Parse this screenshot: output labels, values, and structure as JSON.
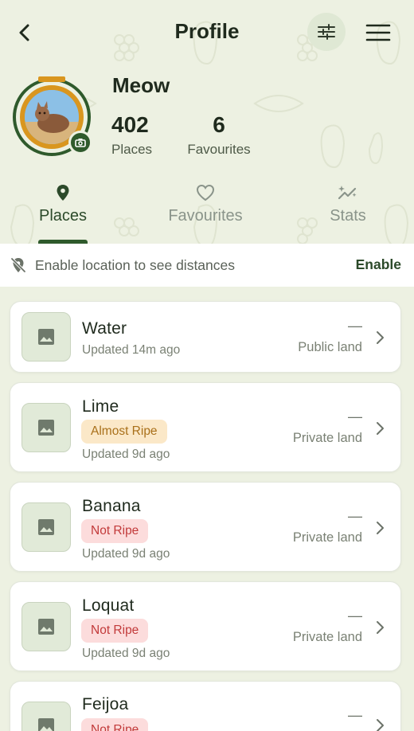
{
  "header": {
    "title": "Profile",
    "back_icon": "chevron-left-icon",
    "filter_icon": "sliders-icon",
    "menu_icon": "hamburger-menu-icon"
  },
  "profile": {
    "name": "Meow",
    "places_count": "402",
    "places_label": "Places",
    "favourites_count": "6",
    "favourites_label": "Favourites"
  },
  "tabs": [
    {
      "label": "Places",
      "icon": "map-pin-icon",
      "active": true
    },
    {
      "label": "Favourites",
      "icon": "heart-icon",
      "active": false
    },
    {
      "label": "Stats",
      "icon": "trend-sparkle-icon",
      "active": false
    }
  ],
  "banner": {
    "text": "Enable location to see distances",
    "action": "Enable",
    "icon": "location-off-icon"
  },
  "places": [
    {
      "name": "Water",
      "ripeness": "",
      "updated": "Updated 14m ago",
      "distance": "—",
      "land": "Public land"
    },
    {
      "name": "Lime",
      "ripeness": "Almost Ripe",
      "updated": "Updated 9d ago",
      "distance": "—",
      "land": "Private land"
    },
    {
      "name": "Banana",
      "ripeness": "Not Ripe",
      "updated": "Updated 9d ago",
      "distance": "—",
      "land": "Private land"
    },
    {
      "name": "Loquat",
      "ripeness": "Not Ripe",
      "updated": "Updated 9d ago",
      "distance": "—",
      "land": "Private land"
    },
    {
      "name": "Feijoa",
      "ripeness": "Not Ripe",
      "updated": "",
      "distance": "—",
      "land": ""
    }
  ],
  "colors": {
    "background": "#edf1e2",
    "brand_green": "#2f5a2c",
    "accent_orange": "#d9961f",
    "almost_ripe_bg": "#fbe8c8",
    "not_ripe_bg": "#fcdcdc"
  }
}
